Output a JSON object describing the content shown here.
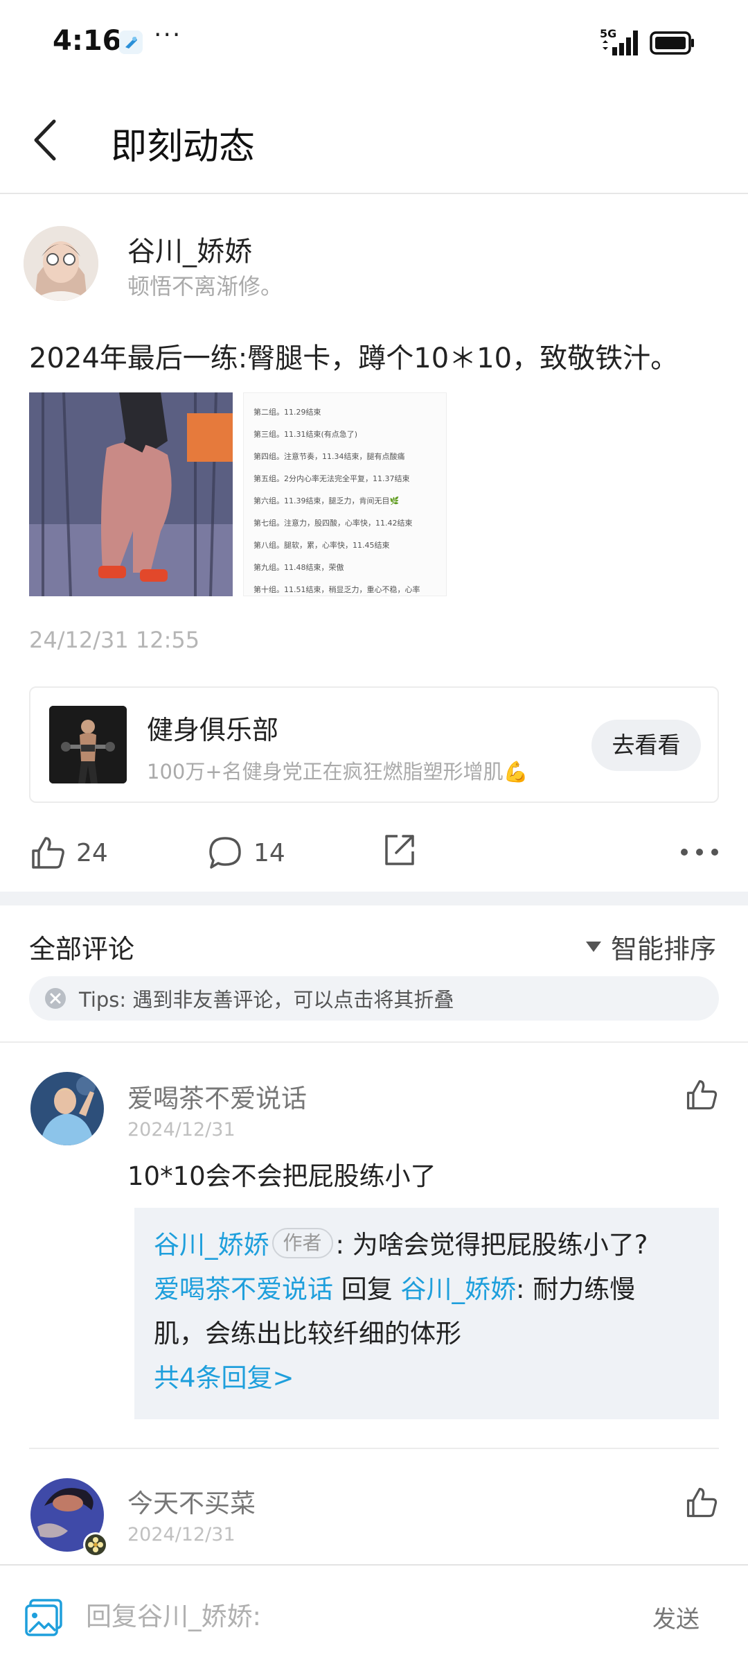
{
  "status_bar": {
    "time": "4:16",
    "dots": "···",
    "network": "5G"
  },
  "header": {
    "title": "即刻动态"
  },
  "post": {
    "author_name": "谷川_娇娇",
    "author_signature": "顿悟不离渐修。",
    "text": "2024年最后一练:臀腿卡，蹲个10＊10，致敬铁汁。",
    "time": "24/12/31 12:55",
    "note_lines": [
      "第二组。11.29结束",
      "第三组。11.31结束(有点急了)",
      "第四组。注意节奏，11.34结束，腿有点酸痛",
      "第五组。2分内心率无法完全平复，11.37结束",
      "第六组。11.39结束，腿乏力，肯间无目🌿",
      "第七组。注意力，股四酸，心率快，11.42结束",
      "第八组。腿软，累，心率快，11.45结束",
      "第九组。11.48结束，荣傲",
      "第十组。11.51结束，稍显乏力，重心不稳，心率"
    ]
  },
  "group_card": {
    "name": "健身俱乐部",
    "description": "100万+名健身党正在疯狂燃脂塑形增肌💪",
    "button_label": "去看看"
  },
  "actions": {
    "likes": "24",
    "comments": "14"
  },
  "comments_section": {
    "title": "全部评论",
    "sort_label": "智能排序",
    "tips": "Tips: 遇到非友善评论，可以点击将其折叠"
  },
  "comments": [
    {
      "name": "爱喝茶不爱说话",
      "date": "2024/12/31",
      "text": "10*10会不会把屁股练小了",
      "replies": {
        "r1_author": "谷川_娇娇",
        "r1_tag": "作者",
        "r1_text": ": 为啥会觉得把屁股练小了?",
        "r2_author": "爱喝茶不爱说话",
        "r2_verb": " 回复 ",
        "r2_target": "谷川_娇娇",
        "r2_text_a": ": 耐力练慢",
        "r2_text_b": "肌，会练出比较纤细的体形",
        "more": "共4条回复>"
      }
    },
    {
      "name": "今天不买菜",
      "date": "2024/12/31"
    }
  ],
  "bottom_bar": {
    "placeholder": "回复谷川_娇娇:",
    "send_label": "发送"
  },
  "colors": {
    "link_blue": "#1e9fdc",
    "divider": "#f0f2f5",
    "reply_bg": "#eff2f6"
  }
}
